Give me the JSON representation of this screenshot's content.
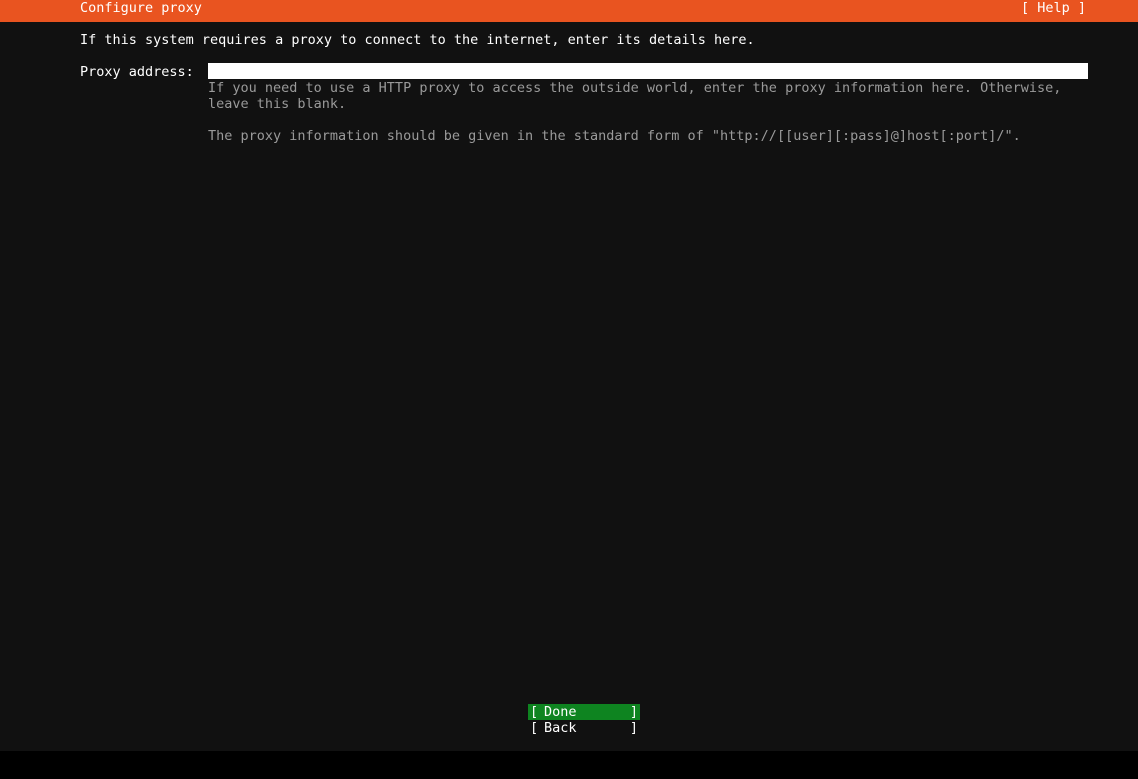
{
  "header": {
    "title": "Configure proxy",
    "help_label": "[ Help ]"
  },
  "intro_text": "If this system requires a proxy to connect to the internet, enter its details here.",
  "proxy": {
    "label": "Proxy address:",
    "value": "",
    "hint_1": "If you need to use a HTTP proxy to access the outside world, enter the proxy information here. Otherwise, leave this blank.",
    "hint_2": "The proxy information should be given in the standard form of \"http://[[user][:pass]@]host[:port]/\"."
  },
  "buttons": {
    "bracket_open": "[",
    "bracket_close": "]",
    "done_label": "Done",
    "back_label": "Back"
  },
  "colors": {
    "accent": "#e95420",
    "background": "#111111",
    "button_selected": "#0e8420",
    "hint_text": "#9a9a9a"
  }
}
